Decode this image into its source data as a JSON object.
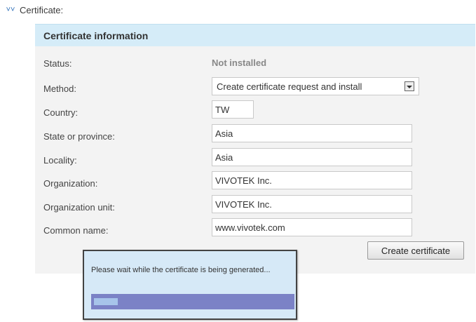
{
  "section": {
    "chevron_icon": "double-chevron-down-icon",
    "title": "Certificate:"
  },
  "panel": {
    "title": "Certificate information",
    "status_label": "Status:",
    "status_value": "Not installed",
    "method_label": "Method:",
    "method_value": "Create certificate request and install",
    "country_label": "Country:",
    "country_value": "TW",
    "state_label": "State or province:",
    "state_value": "Asia",
    "locality_label": "Locality:",
    "locality_value": "Asia",
    "organization_label": "Organization:",
    "organization_value": "VIVOTEK Inc.",
    "org_unit_label": "Organization unit:",
    "org_unit_value": "VIVOTEK Inc.",
    "common_name_label": "Common name:",
    "common_name_value": "www.vivotek.com",
    "create_button": "Create certificate"
  },
  "dialog": {
    "message": "Please wait while the certificate is being generated...",
    "progress": 0.12
  },
  "colors": {
    "header_bg": "#d5ecf8",
    "dialog_bg": "#d6e9f7",
    "progress_track": "#7b82c6",
    "progress_fill": "#a7c4ea"
  }
}
